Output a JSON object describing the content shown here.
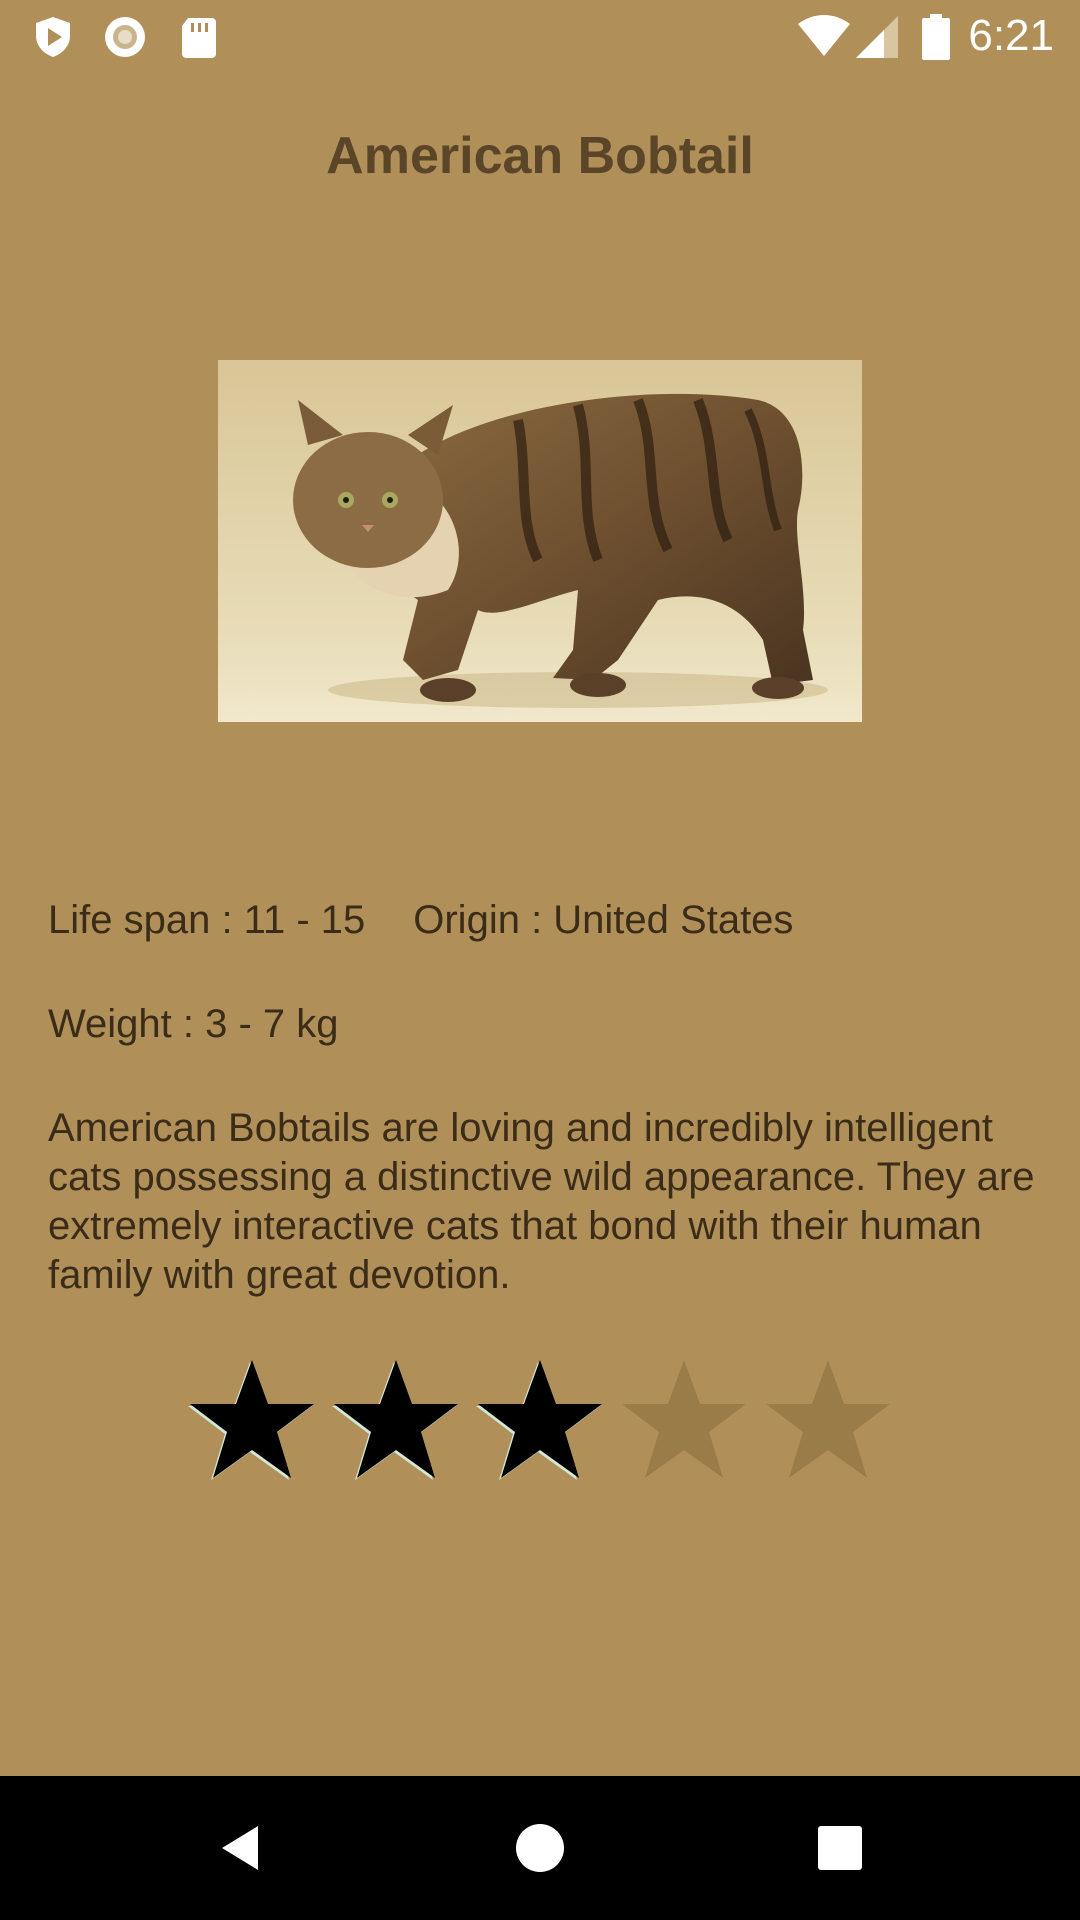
{
  "status_bar": {
    "time": "6:21",
    "left_icons": [
      "shield-play-icon",
      "record-icon",
      "sd-card-icon"
    ],
    "right_icons": [
      "wifi-icon",
      "cell-signal-icon",
      "battery-icon"
    ]
  },
  "breed": {
    "title": "American Bobtail",
    "image": "american-bobtail-cat-photo",
    "life_span": "Life span : 11 - 15",
    "origin": "Origin : United States",
    "weight": "Weight : 3 - 7 kg",
    "description_lines": [
      "American Bobtails are loving and incredibly intelligent",
      "cats possessing a distinctive wild appearance. They are",
      "extremely interactive cats that bond with their human",
      "family with great devotion."
    ]
  },
  "rating": {
    "value": 3,
    "max": 5,
    "filled_color": "#000000",
    "empty_color": "#9A7C48"
  },
  "nav_bar": {
    "buttons": [
      "back-icon",
      "home-icon",
      "recents-icon"
    ]
  },
  "colors": {
    "background": "#B09058",
    "title": "#5A4528",
    "text": "#3A2C18"
  }
}
